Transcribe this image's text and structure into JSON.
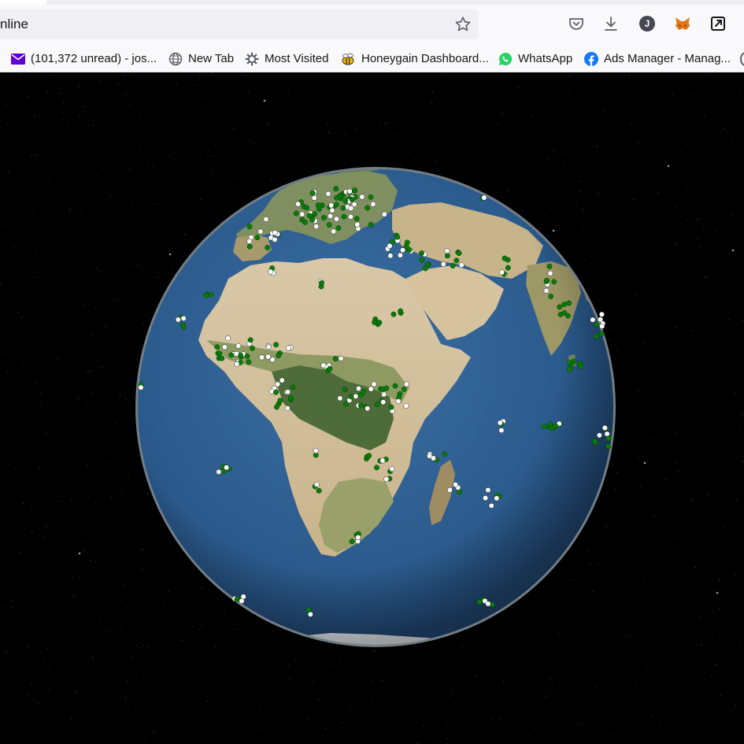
{
  "browser": {
    "url_text": "nline",
    "toolbar_icons": [
      "star-icon",
      "pocket-icon",
      "download-icon",
      "account-avatar-icon",
      "metamask-fox-icon",
      "extensions-share-icon"
    ],
    "avatar_letter": "J",
    "colors": {
      "chrome": "#f9f9fb",
      "urlbar": "#f0f0f4",
      "text": "#15141a",
      "avatar": "#474752",
      "metamask": "#e2761b"
    }
  },
  "bookmarks": [
    {
      "label": "(101,372 unread) - jos...",
      "icon": "mail-icon",
      "color": "#6001d2"
    },
    {
      "label": "New Tab",
      "icon": "globe-icon",
      "color": "#5b5b66"
    },
    {
      "label": "Most Visited",
      "icon": "gear-icon",
      "color": "#5b5b66"
    },
    {
      "label": "Honeygain Dashboard...",
      "icon": "honeygain-bee-icon",
      "color": "#f5b800"
    },
    {
      "label": "WhatsApp",
      "icon": "whatsapp-icon",
      "color": "#25d366"
    },
    {
      "label": "Ads Manager - Manag...",
      "icon": "facebook-icon",
      "color": "#1877f2"
    }
  ],
  "map": {
    "view": "3D globe centred on Africa",
    "background": "#000000",
    "marker_colors": {
      "green": "#0a7a0a",
      "white": "#ffffff"
    },
    "marker_legend_shown": false
  }
}
